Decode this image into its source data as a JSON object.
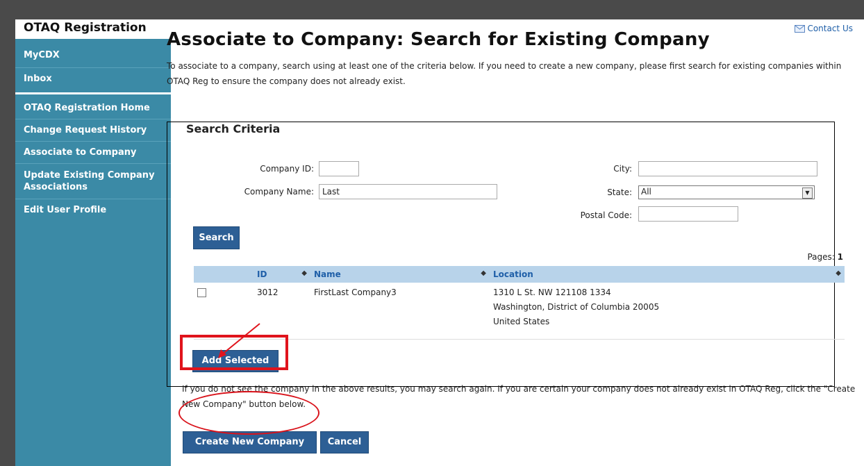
{
  "header": {
    "app_title": "OTAQ Registration",
    "contact_label": "Contact Us"
  },
  "sidebar": {
    "items": [
      {
        "label": "MyCDX"
      },
      {
        "label": "Inbox"
      },
      {
        "label": "OTAQ Registration Home"
      },
      {
        "label": "Change Request History"
      },
      {
        "label": "Associate to Company"
      },
      {
        "label": "Update Existing Company Associations"
      },
      {
        "label": "Edit User Profile"
      }
    ]
  },
  "page": {
    "title": "Associate to Company: Search for Existing Company",
    "intro": "To associate to a company, search using at least one of the criteria below. If you need to create a new company, please first search for existing companies within OTAQ Reg to ensure the company does not already exist."
  },
  "search": {
    "legend": "Search Criteria",
    "company_id_label": "Company ID:",
    "company_id_value": "",
    "company_name_label": "Company Name:",
    "company_name_value": "Last",
    "city_label": "City:",
    "city_value": "",
    "state_label": "State:",
    "state_value": "All",
    "postal_code_label": "Postal Code:",
    "postal_code_value": "",
    "search_button": "Search"
  },
  "results": {
    "pages_label": "Pages:",
    "pages_value": "1",
    "columns": [
      "ID",
      "Name",
      "Location"
    ],
    "rows": [
      {
        "id": "3012",
        "name": "FirstLast Company3",
        "location_line1": "1310 L St. NW 121108 1334",
        "location_line2": "Washington, District of Columbia 20005",
        "location_line3": "United States"
      }
    ],
    "add_selected_button": "Add Selected"
  },
  "footer": {
    "notice": "If you do not see the company in the above results, you may search again. If you are certain your company does not already exist in OTAQ Reg, click the \"Create New Company\" button below.",
    "create_button": "Create New Company",
    "cancel_button": "Cancel"
  },
  "colors": {
    "sidebar_bg": "#3b8aa6",
    "button_bg": "#2d5f95",
    "table_header_bg": "#b8d3ea",
    "annotation_red": "#e0141c"
  }
}
